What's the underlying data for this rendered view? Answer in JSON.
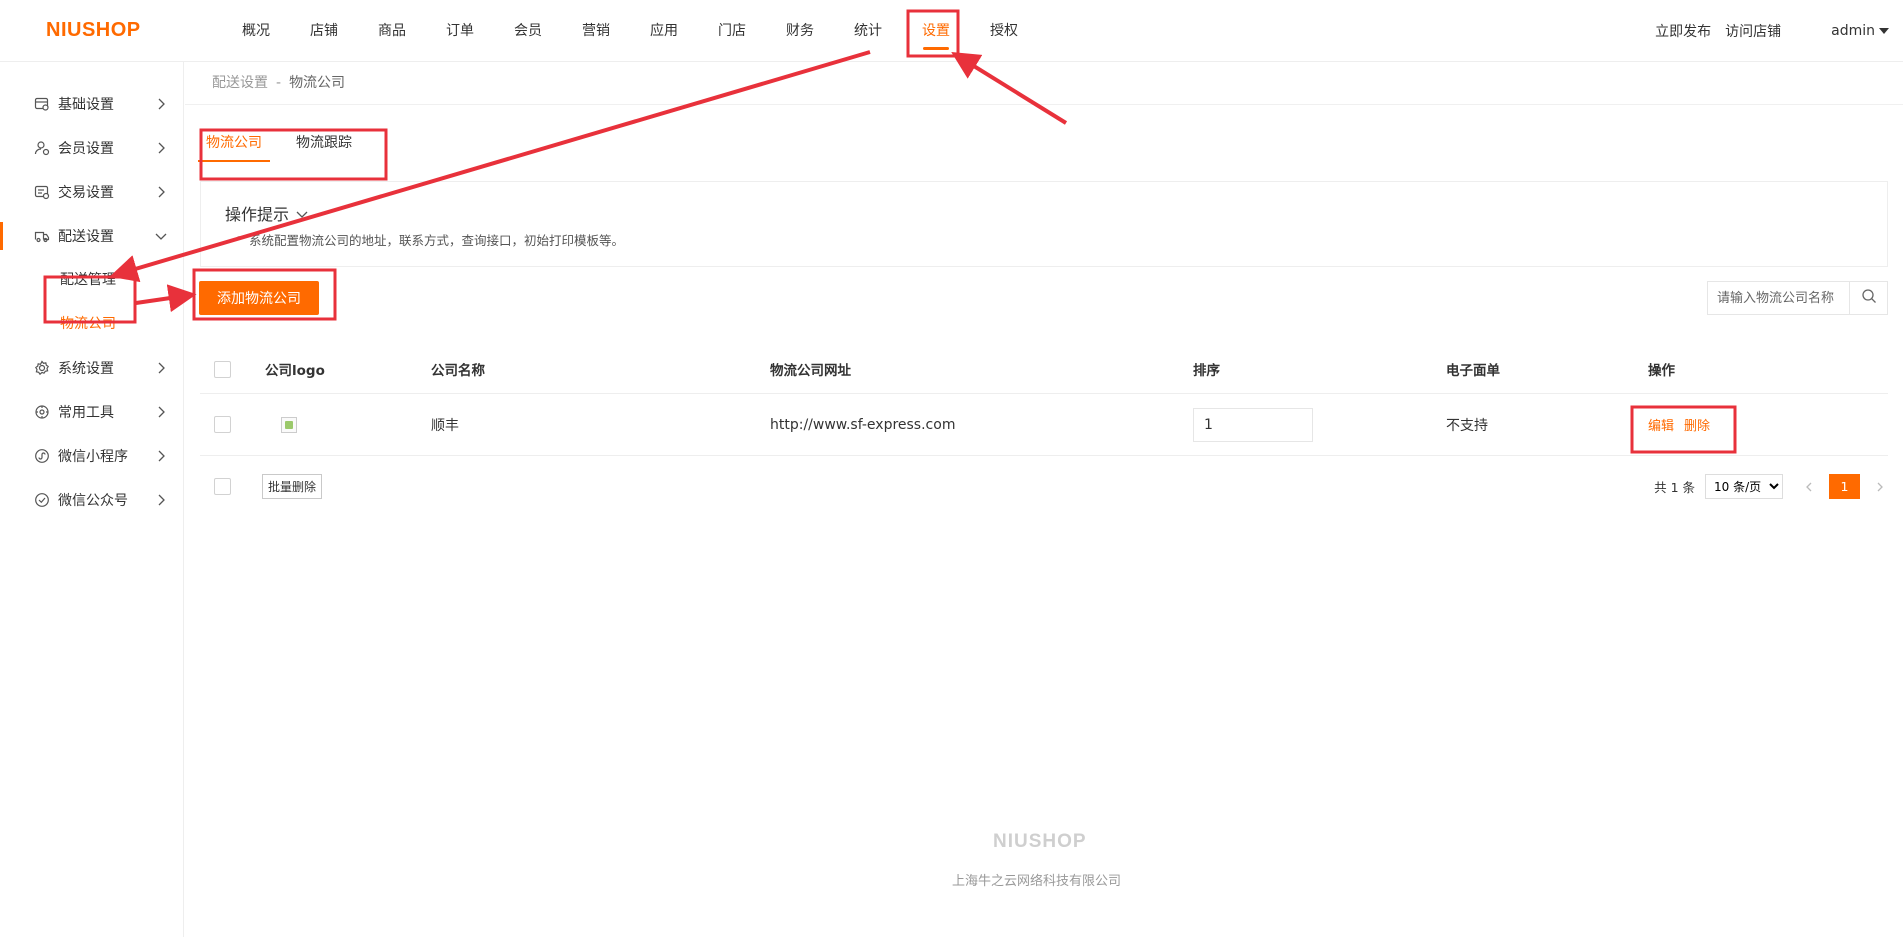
{
  "header": {
    "logo": "NIUSHOP",
    "nav": [
      "概况",
      "店铺",
      "商品",
      "订单",
      "会员",
      "营销",
      "应用",
      "门店",
      "财务",
      "统计",
      "设置",
      "授权"
    ],
    "active_nav": "设置",
    "publish": "立即发布",
    "visit_store": "访问店铺",
    "user": "admin"
  },
  "sidebar": {
    "items": [
      {
        "label": "基础设置",
        "icon": "store-settings-icon"
      },
      {
        "label": "会员设置",
        "icon": "member-icon"
      },
      {
        "label": "交易设置",
        "icon": "trade-icon"
      },
      {
        "label": "配送设置",
        "icon": "truck-icon"
      },
      {
        "label": "系统设置",
        "icon": "gear-icon"
      },
      {
        "label": "常用工具",
        "icon": "tools-icon"
      },
      {
        "label": "微信小程序",
        "icon": "miniprogram-icon"
      },
      {
        "label": "微信公众号",
        "icon": "wechat-official-icon"
      }
    ],
    "delivery_sub": [
      "配送管理",
      "物流公司"
    ],
    "active_sub": "物流公司"
  },
  "breadcrumb": {
    "parent": "配送设置",
    "separator": "-",
    "current": "物流公司"
  },
  "tabs": [
    "物流公司",
    "物流跟踪"
  ],
  "active_tab": "物流公司",
  "tip": {
    "title": "操作提示",
    "text": "系统配置物流公司的地址，联系方式，查询接口，初始打印模板等。"
  },
  "add_button": "添加物流公司",
  "search": {
    "placeholder": "请输入物流公司名称"
  },
  "table": {
    "headers": [
      "公司logo",
      "公司名称",
      "物流公司网址",
      "排序",
      "电子面单",
      "操作"
    ],
    "rows": [
      {
        "name": "顺丰",
        "url": "http://www.sf-express.com",
        "sort": "1",
        "eorder": "不支持",
        "edit": "编辑",
        "delete": "删除"
      }
    ]
  },
  "batch_delete": "批量删除",
  "pagination": {
    "total": "共 1 条",
    "page_size": "10 条/页",
    "current": "1"
  },
  "footer": {
    "logo": "NIUSHOP",
    "company": "上海牛之云网络科技有限公司"
  },
  "colors": {
    "accent": "#ff6a00",
    "annotation": "#e8313b"
  }
}
